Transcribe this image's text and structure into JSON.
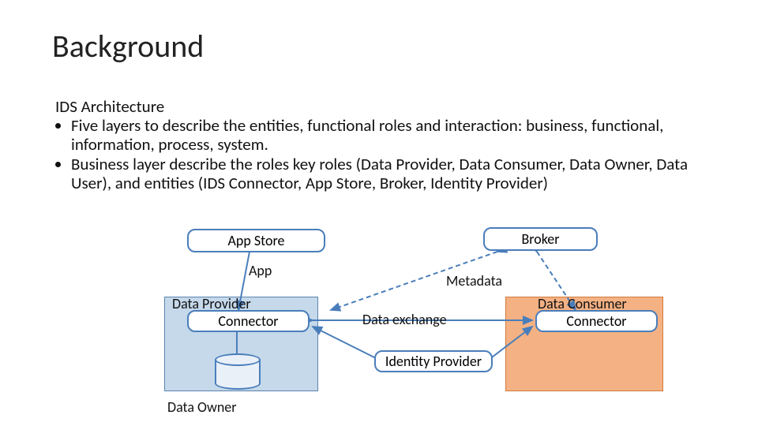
{
  "title": "Background",
  "subtitle": "IDS Architecture",
  "bullets": [
    "Five layers to describe the entities, functional roles and interaction: business, functional, information, process, system.",
    "Business layer describe the roles key roles (Data Provider, Data Consumer, Data Owner, Data User), and entities (IDS Connector, App Store, Broker, Identity Provider)"
  ],
  "boxes": {
    "app_store": "App Store",
    "broker": "Broker",
    "connector_left": "Connector",
    "connector_right": "Connector",
    "identity_provider": "Identity Provider"
  },
  "panel_titles": {
    "provider": "Data Provider",
    "consumer": "Data Consumer",
    "owner": "Data Owner"
  },
  "labels": {
    "app": "App",
    "metadata": "Metadata",
    "data_exchange": "Data exchange"
  },
  "colors": {
    "stroke_blue": "#4a7ebb",
    "panel_blue_fill": "#c5d9ea",
    "panel_orange_fill": "#f4b183"
  }
}
